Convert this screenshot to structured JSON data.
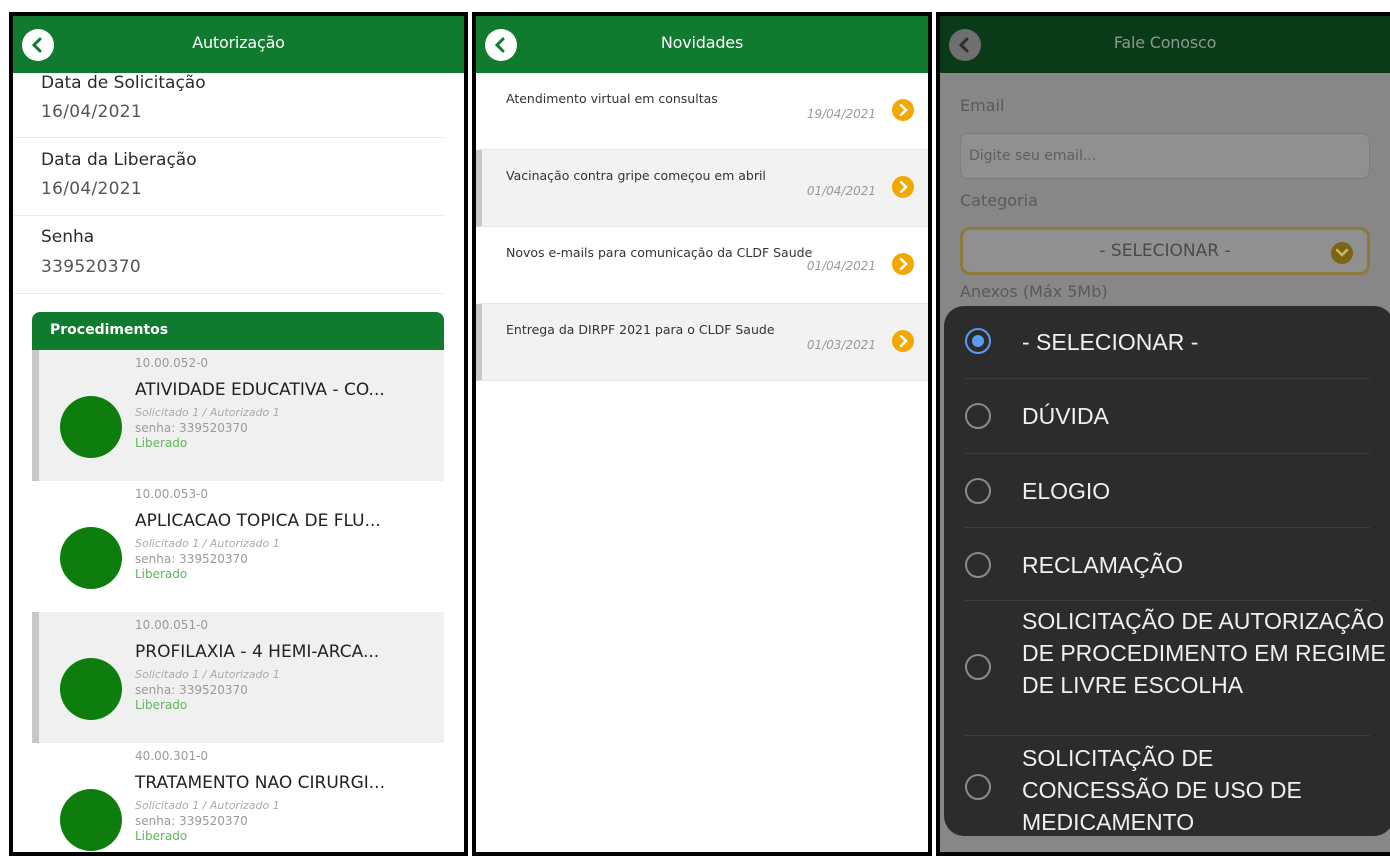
{
  "autorizacao": {
    "title": "Autorização",
    "fields": [
      {
        "label": "Data de Solicitação",
        "value": "16/04/2021"
      },
      {
        "label": "Data da Liberação",
        "value": "16/04/2021"
      },
      {
        "label": "Senha",
        "value": "339520370"
      }
    ],
    "procedimentos_title": "Procedimentos",
    "procedimentos": [
      {
        "code": "10.00.052-0",
        "name": "ATIVIDADE EDUCATIVA - CO...",
        "sub": "Solicitado 1 / Autorizado 1",
        "senha": "senha: 339520370",
        "status": "Liberado"
      },
      {
        "code": "10.00.053-0",
        "name": "APLICACAO TOPICA DE FLU...",
        "sub": "Solicitado 1 / Autorizado 1",
        "senha": "senha: 339520370",
        "status": "Liberado"
      },
      {
        "code": "10.00.051-0",
        "name": "PROFILAXIA - 4 HEMI-ARCA...",
        "sub": "Solicitado 1 / Autorizado 1",
        "senha": "senha: 339520370",
        "status": "Liberado"
      },
      {
        "code": "40.00.301-0",
        "name": "TRATAMENTO NAO CIRURGI...",
        "sub": "Solicitado 1 / Autorizado 1",
        "senha": "senha: 339520370",
        "status": "Liberado"
      }
    ]
  },
  "novidades": {
    "title": "Novidades",
    "items": [
      {
        "title": "Atendimento virtual em consultas",
        "date": "19/04/2021"
      },
      {
        "title": "Vacinação contra gripe começou em abril",
        "date": "01/04/2021"
      },
      {
        "title": "Novos e-mails para comunicação da CLDF Saude",
        "date": "01/04/2021"
      },
      {
        "title": "Entrega da DIRPF 2021 para o CLDF Saude",
        "date": "01/03/2021"
      }
    ]
  },
  "fale_conosco": {
    "title": "Fale Conosco",
    "email_label": "Email",
    "email_placeholder": "Digite seu email...",
    "categoria_label": "Categoria",
    "categoria_value": "- SELECIONAR -",
    "anexos_label": "Anexos (Máx 5Mb)",
    "options": [
      {
        "label": "- SELECIONAR -",
        "selected": true
      },
      {
        "label": "DÚVIDA",
        "selected": false
      },
      {
        "label": "ELOGIO",
        "selected": false
      },
      {
        "label": "RECLAMAÇÃO",
        "selected": false
      },
      {
        "label": "SOLICITAÇÃO DE AUTORIZAÇÃO DE PROCEDIMENTO EM REGIME DE LIVRE ESCOLHA",
        "selected": false
      },
      {
        "label": "SOLICITAÇÃO DE CONCESSÃO DE USO DE MEDICAMENTO",
        "selected": false
      }
    ]
  },
  "colors": {
    "header_green": "#107a2e",
    "accent_orange": "#f3a800",
    "status_green": "#5cb85c",
    "radio_blue": "#5b9bf3"
  }
}
